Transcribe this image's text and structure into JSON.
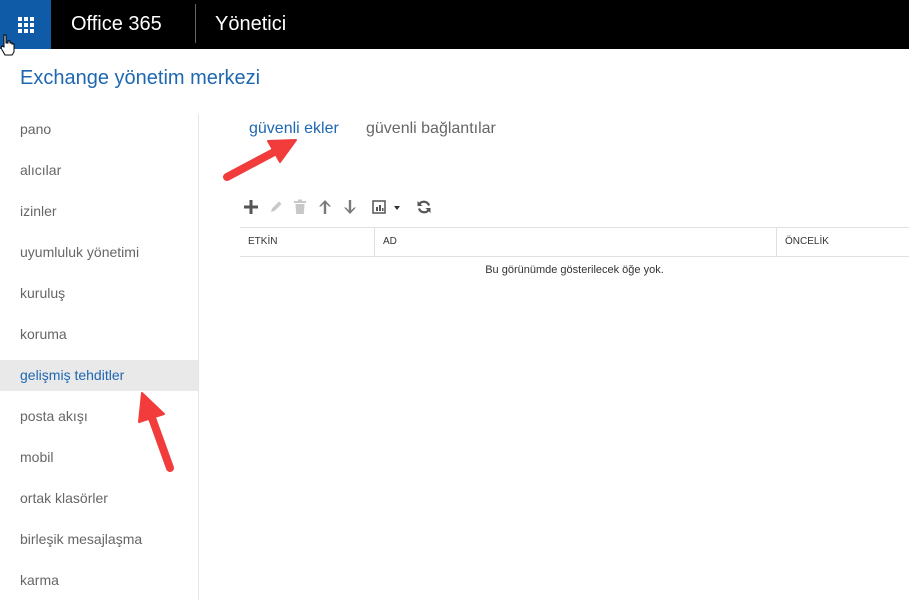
{
  "topbar": {
    "brand": "Office 365",
    "app": "Yönetici"
  },
  "header": {
    "title": "Exchange yönetim merkezi"
  },
  "sidebar": {
    "items": [
      {
        "label": "pano"
      },
      {
        "label": "alıcılar"
      },
      {
        "label": "izinler"
      },
      {
        "label": "uyumluluk yönetimi"
      },
      {
        "label": "kuruluş"
      },
      {
        "label": "koruma"
      },
      {
        "label": "gelişmiş tehditler",
        "active": true
      },
      {
        "label": "posta akışı"
      },
      {
        "label": "mobil"
      },
      {
        "label": "ortak klasörler"
      },
      {
        "label": "birleşik mesajlaşma"
      },
      {
        "label": "karma"
      }
    ]
  },
  "tabs": [
    {
      "label": "güvenli ekler",
      "active": true
    },
    {
      "label": "güvenli bağlantılar",
      "active": false
    }
  ],
  "toolbar": {
    "icons": [
      "add-icon",
      "edit-icon",
      "delete-icon",
      "move-up-icon",
      "move-down-icon",
      "more-options-icon",
      "refresh-icon"
    ]
  },
  "table": {
    "columns": [
      "ETKİN",
      "AD",
      "ÖNCELİK"
    ],
    "empty_message": "Bu görünümde gösterilecek öğe yok."
  },
  "colors": {
    "accent": "#1e67b1",
    "waffle": "#0f5ba7",
    "topbar": "#000000",
    "annotation_arrow": "#f23c3c"
  }
}
